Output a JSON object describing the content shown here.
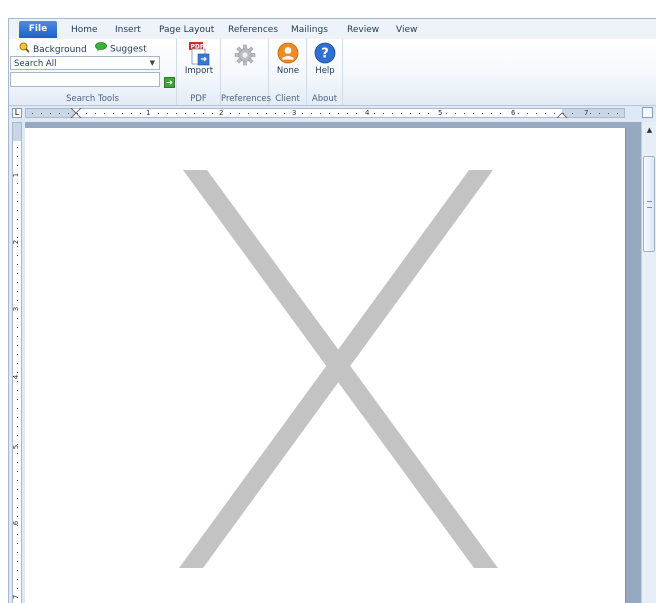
{
  "tabs": [
    {
      "label": "File"
    },
    {
      "label": "Home"
    },
    {
      "label": "Insert"
    },
    {
      "label": "Page Layout"
    },
    {
      "label": "References"
    },
    {
      "label": "Mailings"
    },
    {
      "label": "Review"
    },
    {
      "label": "View"
    }
  ],
  "ribbon": {
    "search_tools": {
      "background_label": "Background",
      "suggest_label": "Suggest",
      "search_select_value": "Search All",
      "search_input_value": "",
      "group_label": "Search Tools"
    },
    "pdf": {
      "import_label": "Import",
      "group_label": "PDF"
    },
    "preferences": {
      "group_label": "Preferences"
    },
    "client": {
      "none_label": "None",
      "group_label": "Client"
    },
    "about": {
      "help_label": "Help",
      "group_label": "About"
    }
  },
  "ruler": {
    "h_numbers": [
      "1",
      "2",
      "3",
      "4",
      "5",
      "6",
      "7"
    ],
    "v_numbers": [
      "1",
      "2",
      "3",
      "4",
      "5",
      "6",
      "7"
    ]
  },
  "icons": {
    "background": "magnifier-icon",
    "suggest": "speech-bubble-icon",
    "go": "arrow-right-icon",
    "import": "pdf-import-icon",
    "preferences": "gear-icon",
    "client": "user-icon",
    "help": "help-icon"
  },
  "colors": {
    "file_tab": "#2b6fd4",
    "ribbon_bg": "#f3f7fc",
    "doc_bg": "#97a9c1",
    "placeholder_x": "#c3c3c3"
  }
}
